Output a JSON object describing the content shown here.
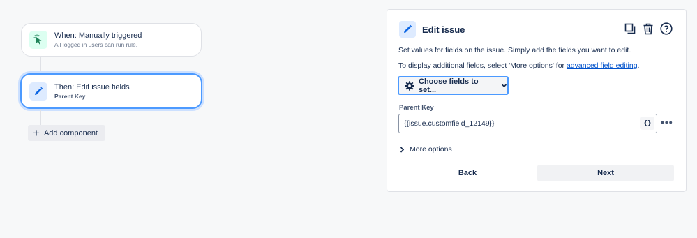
{
  "flow": {
    "trigger": {
      "title": "When: Manually triggered",
      "subtitle": "All logged in users can run rule.",
      "icon": "cursor-click-icon"
    },
    "action": {
      "title": "Then: Edit issue fields",
      "subtitle": "Parent Key",
      "icon": "pencil-icon"
    },
    "add_component_label": "Add component"
  },
  "panel": {
    "title": "Edit issue",
    "description": "Set values for fields on the issue. Simply add the fields you want to edit.",
    "more_fields_prefix": "To display additional fields, select 'More options' for ",
    "more_fields_link": "advanced field editing",
    "more_fields_suffix": ".",
    "choose_fields_label": "Choose fields to set...",
    "field": {
      "label": "Parent Key",
      "value": "{{issue.customfield_12149}}",
      "smart_value_button": "{}"
    },
    "more_options_label": "More options",
    "back_label": "Back",
    "next_label": "Next"
  },
  "colors": {
    "accent": "#4c9aff",
    "link": "#0052cc",
    "trigger_icon_bg": "#dcfff1",
    "action_icon_bg": "#deebff"
  }
}
